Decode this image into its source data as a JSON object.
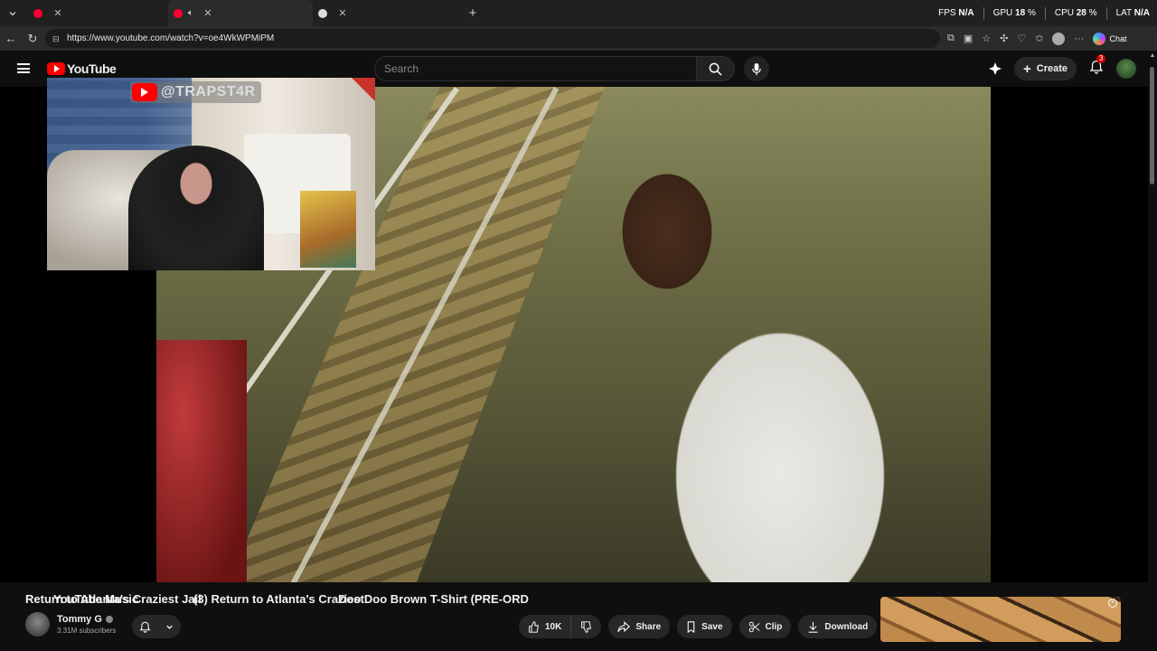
{
  "browser": {
    "tabs": [
      {
        "title": "YouTube Music",
        "favicon_color": "#ff0033"
      },
      {
        "title": "(3) Return to Atlanta's Craziest",
        "favicon_color": "#ff0033"
      },
      {
        "title": "Doo Doo Brown T-Shirt (PRE-ORD",
        "favicon_color": "#dddddd"
      }
    ],
    "url": "https://www.youtube.com/watch?v=oe4WkWPMiPM",
    "chat_label": "Chat"
  },
  "hud": {
    "fps_label": "FPS",
    "fps_value": "N/A",
    "gpu_label": "GPU",
    "gpu_value": "18",
    "cpu_label": "CPU",
    "cpu_value": "28",
    "lat_label": "LAT",
    "lat_value": "N/A",
    "percent": "%"
  },
  "youtube": {
    "logo_text": "YouTube",
    "search_placeholder": "Search",
    "create_label": "Create",
    "notifications_count": "3"
  },
  "pip": {
    "channel_tag": "@TRAPST4R"
  },
  "video": {
    "title": "Return to Atlanta's Craziest Jail",
    "channel_name": "Tommy G",
    "subscribers": "3.31M subscribers",
    "likes": "10K",
    "share_label": "Share",
    "save_label": "Save",
    "clip_label": "Clip",
    "download_label": "Download"
  },
  "colors": {
    "accent": "#ff0000",
    "background": "#0f0f0f",
    "pill": "#272727"
  }
}
